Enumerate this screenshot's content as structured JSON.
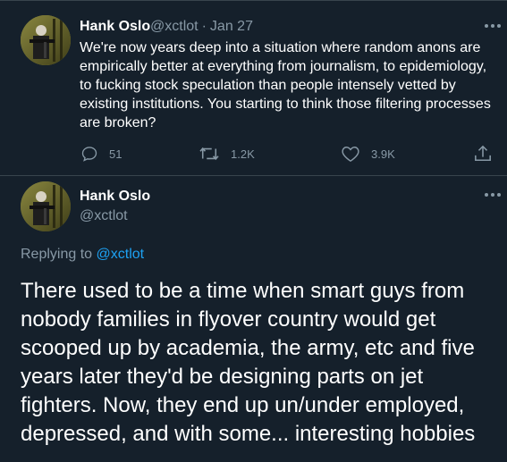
{
  "tweet1": {
    "name": "Hank Oslo",
    "handle": "@xctlot",
    "sep": "·",
    "date": "Jan 27",
    "text": "We're now years deep into a situation where random anons are empirically better at everything from journalism, to epidemiology, to fucking stock speculation than people intensely vetted by existing institutions. You starting to think those filtering processes are broken?",
    "replies": "51",
    "retweets": "1.2K",
    "likes": "3.9K"
  },
  "tweet2": {
    "name": "Hank Oslo",
    "handle": "@xctlot",
    "replying_prefix": "Replying to",
    "replying_handle": "@xctlot",
    "text": "There used to be a time when smart guys from nobody families in flyover country would get scooped up by academia, the army, etc and five years later they'd be designing parts on jet fighters. Now, they end up un/under employed, depressed, and with some... interesting hobbies"
  },
  "colors": {
    "background": "#15202b",
    "text": "#ffffff",
    "muted": "#8899a6",
    "link": "#1da1f2",
    "divider": "#38444d"
  }
}
